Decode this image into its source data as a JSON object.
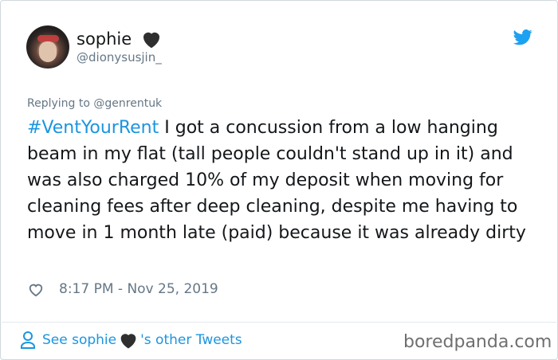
{
  "user": {
    "name": "sophie",
    "handle": "@dionysusjin_"
  },
  "reply": {
    "prefix": "Replying to ",
    "mention": "@genrentuk"
  },
  "tweet": {
    "hashtag": "#VentYourRent",
    "body": " I got a concussion from a low hanging beam in my flat (tall people couldn't stand up in it) and was also charged 10% of my deposit when moving for cleaning fees after deep cleaning, despite me having to move in 1 month late (paid) because it was already dirty"
  },
  "meta": {
    "timestamp": "8:17 PM - Nov 25, 2019"
  },
  "footer": {
    "see_prefix": "See sophie ",
    "see_suffix": "'s other Tweets",
    "brand": "boredpanda.com"
  },
  "icons": {
    "heart_emoji": "black-heart-icon",
    "twitter": "twitter-bird-icon",
    "like": "heart-outline-icon",
    "person": "person-icon"
  },
  "colors": {
    "link_blue": "#1b95e0",
    "text_dark": "#14171a",
    "muted": "#657786"
  }
}
